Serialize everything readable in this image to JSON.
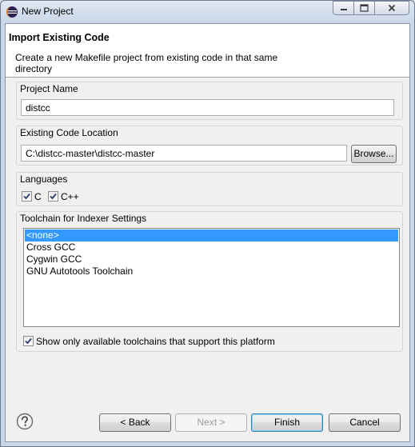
{
  "window": {
    "title": "New Project"
  },
  "header": {
    "title": "Import Existing Code",
    "description": "Create a new Makefile project from existing code in that same directory"
  },
  "project_name": {
    "label": "Project Name",
    "value": "distcc"
  },
  "code_location": {
    "label": "Existing Code Location",
    "value": "C:\\distcc-master\\distcc-master",
    "browse_label": "Browse..."
  },
  "languages": {
    "label": "Languages",
    "items": [
      {
        "label": "C",
        "checked": true
      },
      {
        "label": "C++",
        "checked": true
      }
    ]
  },
  "toolchain": {
    "label": "Toolchain for Indexer Settings",
    "items": [
      "<none>",
      "Cross GCC",
      "Cygwin GCC",
      "GNU Autotools Toolchain"
    ],
    "selected_index": 0,
    "filter_label": "Show only available toolchains that support this platform",
    "filter_checked": true
  },
  "footer": {
    "back_label": "< Back",
    "next_label": "Next >",
    "finish_label": "Finish",
    "cancel_label": "Cancel"
  },
  "icons": {
    "app": "eclipse-icon",
    "help": "help-icon",
    "minimize": "minimize-icon",
    "maximize": "maximize-icon",
    "close": "close-icon"
  },
  "colors": {
    "selection": "#3399ff",
    "close_button": "#c75050"
  }
}
